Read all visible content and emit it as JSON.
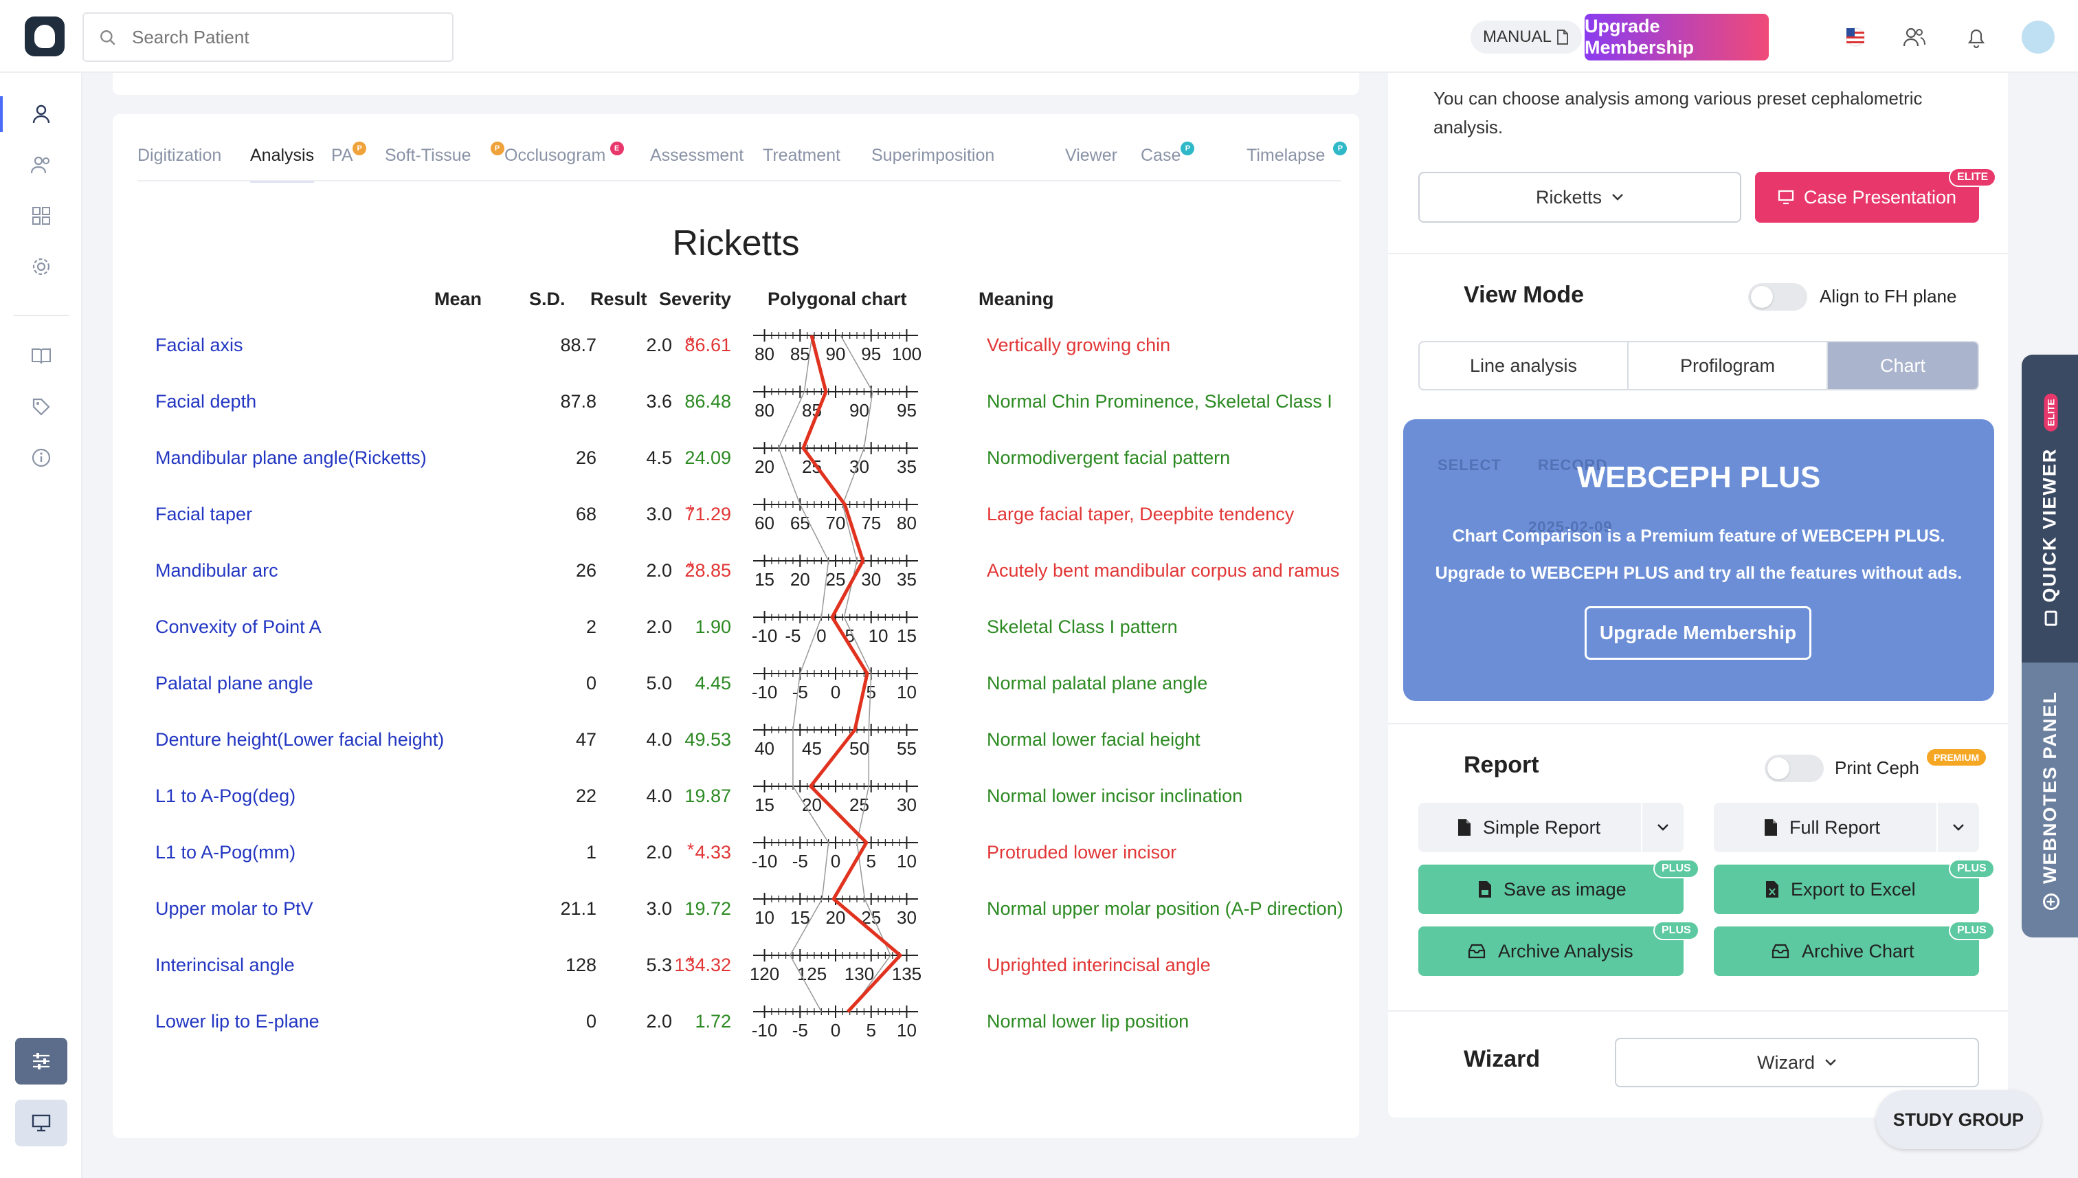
{
  "topbar": {
    "search_placeholder": "Search Patient",
    "manual_label": "MANUAL",
    "upgrade_label": "Upgrade Membership"
  },
  "tabs": [
    {
      "label": "Digitization",
      "badge": ""
    },
    {
      "label": "Analysis",
      "badge": ""
    },
    {
      "label": "PA",
      "badge": "P"
    },
    {
      "label": "Soft-Tissue",
      "badge": "P"
    },
    {
      "label": "Occlusogram",
      "badge": "E"
    },
    {
      "label": "Assessment",
      "badge": ""
    },
    {
      "label": "Treatment",
      "badge": ""
    },
    {
      "label": "Superimposition",
      "badge": ""
    },
    {
      "label": "Viewer",
      "badge": ""
    },
    {
      "label": "Case",
      "badge": "P"
    },
    {
      "label": "Timelapse",
      "badge": "P"
    }
  ],
  "analysis": {
    "title": "Ricketts",
    "headers": {
      "mean": "Mean",
      "sd": "S.D.",
      "result": "Result",
      "severity": "Severity",
      "chart": "Polygonal chart",
      "meaning": "Meaning"
    },
    "rows": [
      {
        "name": "Facial axis",
        "mean": "88.7",
        "sd": "2.0",
        "result": "86.61",
        "severity": "*",
        "status": "red",
        "ticks": [
          "80",
          "85",
          "90",
          "95",
          "100"
        ],
        "meaning": "Vertically growing chin"
      },
      {
        "name": "Facial depth",
        "mean": "87.8",
        "sd": "3.6",
        "result": "86.48",
        "severity": "",
        "status": "green",
        "ticks": [
          "80",
          "85",
          "90",
          "95"
        ],
        "meaning": "Normal Chin Prominence, Skeletal Class I"
      },
      {
        "name": "Mandibular plane angle(Ricketts)",
        "mean": "26",
        "sd": "4.5",
        "result": "24.09",
        "severity": "",
        "status": "green",
        "ticks": [
          "20",
          "25",
          "30",
          "35"
        ],
        "meaning": "Normodivergent facial pattern"
      },
      {
        "name": "Facial taper",
        "mean": "68",
        "sd": "3.0",
        "result": "71.29",
        "severity": "*",
        "status": "red",
        "ticks": [
          "60",
          "65",
          "70",
          "75",
          "80"
        ],
        "meaning": "Large facial taper, Deepbite tendency"
      },
      {
        "name": "Mandibular arc",
        "mean": "26",
        "sd": "2.0",
        "result": "28.85",
        "severity": "*",
        "status": "red",
        "ticks": [
          "15",
          "20",
          "25",
          "30",
          "35"
        ],
        "meaning": "Acutely bent mandibular corpus and ramus"
      },
      {
        "name": "Convexity of Point A",
        "mean": "2",
        "sd": "2.0",
        "result": "1.90",
        "severity": "",
        "status": "green",
        "ticks": [
          "-10",
          "-5",
          "0",
          "5",
          "10",
          "15"
        ],
        "meaning": "Skeletal Class I pattern"
      },
      {
        "name": "Palatal plane angle",
        "mean": "0",
        "sd": "5.0",
        "result": "4.45",
        "severity": "",
        "status": "green",
        "ticks": [
          "-10",
          "-5",
          "0",
          "5",
          "10"
        ],
        "meaning": "Normal palatal plane angle"
      },
      {
        "name": "Denture height(Lower facial height)",
        "mean": "47",
        "sd": "4.0",
        "result": "49.53",
        "severity": "",
        "status": "green",
        "ticks": [
          "40",
          "45",
          "50",
          "55"
        ],
        "meaning": "Normal lower facial height"
      },
      {
        "name": "L1 to A-Pog(deg)",
        "mean": "22",
        "sd": "4.0",
        "result": "19.87",
        "severity": "",
        "status": "green",
        "ticks": [
          "15",
          "20",
          "25",
          "30"
        ],
        "meaning": "Normal lower incisor inclination"
      },
      {
        "name": "L1 to A-Pog(mm)",
        "mean": "1",
        "sd": "2.0",
        "result": "4.33",
        "severity": "*",
        "status": "red",
        "ticks": [
          "-10",
          "-5",
          "0",
          "5",
          "10"
        ],
        "meaning": "Protruded lower incisor"
      },
      {
        "name": "Upper molar to PtV",
        "mean": "21.1",
        "sd": "3.0",
        "result": "19.72",
        "severity": "",
        "status": "green",
        "ticks": [
          "10",
          "15",
          "20",
          "25",
          "30"
        ],
        "meaning": "Normal upper molar position (A-P direction)"
      },
      {
        "name": "Interincisal angle",
        "mean": "128",
        "sd": "5.3",
        "result": "134.32",
        "severity": "*",
        "status": "red",
        "ticks": [
          "120",
          "125",
          "130",
          "135"
        ],
        "meaning": "Uprighted interincisal angle"
      },
      {
        "name": "Lower lip to E-plane",
        "mean": "0",
        "sd": "2.0",
        "result": "1.72",
        "severity": "",
        "status": "green",
        "ticks": [
          "-10",
          "-5",
          "0",
          "5",
          "10"
        ],
        "meaning": "Normal lower lip position"
      }
    ]
  },
  "right_panel": {
    "description": "You can choose analysis among various preset cephalometric analysis.",
    "analysis_select": "Ricketts",
    "case_presentation": "Case Presentation",
    "elite_badge": "ELITE",
    "view_mode_title": "View Mode",
    "align_fh_label": "Align to FH plane",
    "view_tabs": [
      "Line analysis",
      "Profilogram",
      "Chart"
    ],
    "view_active": "Chart",
    "promo": {
      "ghost_select": "SELECT",
      "ghost_record": "RECORD",
      "ghost_date": "2025-02-09",
      "title": "WEBCEPH PLUS",
      "line1": "Chart Comparison is a Premium feature of WEBCEPH PLUS.",
      "line2": "Upgrade to WEBCEPH PLUS and try all the features without ads.",
      "button": "Upgrade Membership"
    },
    "report_title": "Report",
    "print_ceph_label": "Print Ceph",
    "premium_badge": "PREMIUM",
    "simple_report": "Simple Report",
    "full_report": "Full Report",
    "save_image": "Save as image",
    "export_excel": "Export to Excel",
    "archive_analysis": "Archive Analysis",
    "archive_chart": "Archive Chart",
    "plus_badge": "PLUS",
    "wizard_title": "Wizard",
    "wizard_select": "Wizard"
  },
  "side_tabs": {
    "quick_viewer": "QUICK VIEWER",
    "quick_viewer_badge": "ELITE",
    "webnotes": "WEBNOTES PANEL"
  },
  "study_group": "STUDY GROUP",
  "colors": {
    "accent": "#4a6cf7",
    "link_blue": "#2236c2",
    "normal_green": "#2c8a22",
    "abnormal_red": "#e23636",
    "chart_line": "#e0321e",
    "promo_blue": "#6b8ed6",
    "plus_teal": "#5cc9a0",
    "elite_pink": "#e8376b"
  }
}
